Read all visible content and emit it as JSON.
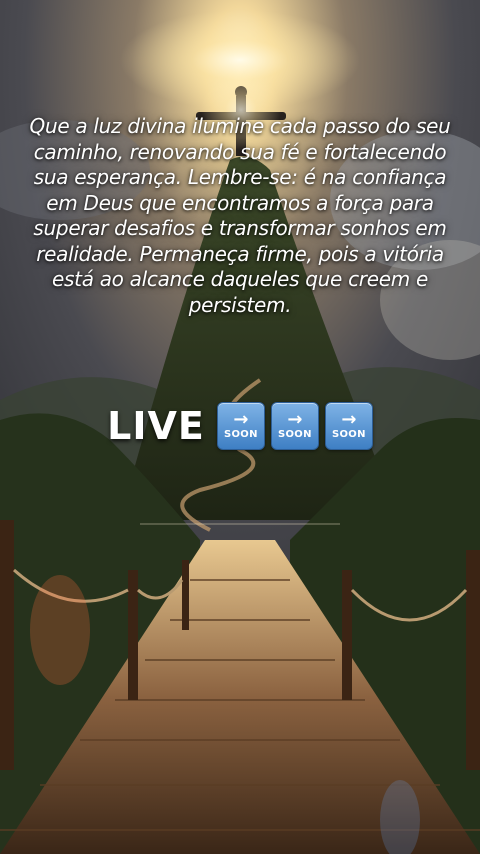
{
  "quote": {
    "text": "Que a luz divina ilumine cada passo do seu caminho, renovando sua fé e fortalecendo sua esperança. Lembre-se: é na confiança em Deus que encontramos a força para superar desafios e transformar sonhos em realidade. Permaneça firme, pois a vitória está ao alcance daqueles que creem e persistem."
  },
  "live": {
    "label": "LIVE",
    "badges": [
      {
        "icon": "soon-arrow-icon",
        "text": "SOON",
        "arrow": "→"
      },
      {
        "icon": "soon-arrow-icon",
        "text": "SOON",
        "arrow": "→"
      },
      {
        "icon": "soon-arrow-icon",
        "text": "SOON",
        "arrow": "→"
      }
    ]
  }
}
